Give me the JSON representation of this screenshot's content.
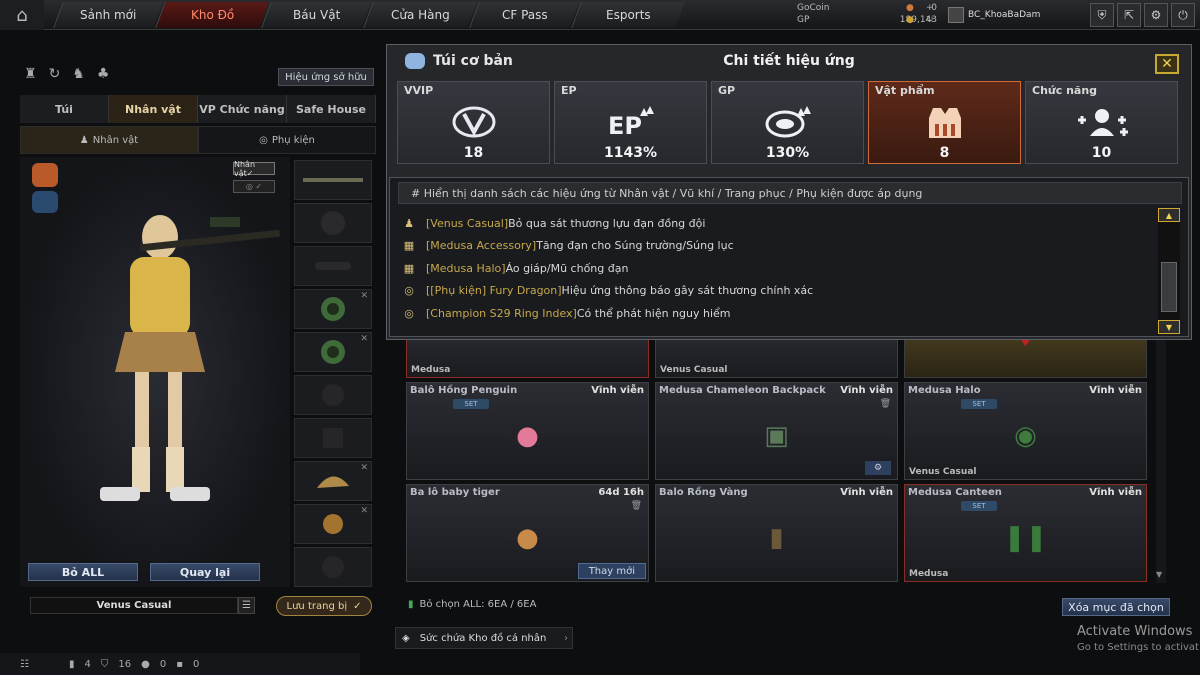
{
  "nav": {
    "tabs": [
      "Sảnh mới",
      "Kho Đồ",
      "Báu Vật",
      "Cửa Hàng",
      "CF Pass",
      "Esports"
    ],
    "active": "Kho Đồ"
  },
  "currency": {
    "gocoin_label": "GoCoin",
    "gocoin_value": "0",
    "gp_label": "GP",
    "gp_value": "189,143"
  },
  "user": {
    "name": "BC_KhoaBaDam"
  },
  "left": {
    "owned_effects_button": "Hiệu ứng sở hữu",
    "tabs": [
      "Túi",
      "Nhân vật",
      "VP Chức năng",
      "Safe House"
    ],
    "active_tab": "Nhân vật",
    "subtabs": [
      "Nhân vật",
      "Phụ kiện"
    ],
    "character_badge": "Nhân vật✓",
    "reset_all": "Bỏ ALL",
    "back": "Quay lại",
    "set_name": "Venus Casual",
    "save": "Lưu trang bị"
  },
  "status_bar": {
    "v1": "4",
    "v2": "16",
    "v3": "0",
    "v4": "0"
  },
  "modal": {
    "bag_title": "Túi cơ bản",
    "title": "Chi tiết hiệu ứng",
    "stats": [
      {
        "label": "VVIP",
        "value": "18",
        "icon": "vvip-icon"
      },
      {
        "label": "EP",
        "value": "1143%",
        "icon": "ep-up-icon"
      },
      {
        "label": "GP",
        "value": "130%",
        "icon": "gp-up-icon"
      },
      {
        "label": "Vật phẩm",
        "value": "8",
        "icon": "vest-icon"
      },
      {
        "label": "Chức năng",
        "value": "10",
        "icon": "users-plus-icon"
      }
    ],
    "effects_header": "# Hiển thị danh sách các hiệu ứng từ Nhân vật / Vũ khí / Trang phục / Phụ kiện được áp dụng",
    "effects": [
      {
        "tag": "[Venus Casual]",
        "text": "Bỏ qua sát thương lựu đạn đồng đội",
        "icon": "character-icon"
      },
      {
        "tag": "[Medusa Accessory]",
        "text": "Tăng đạn cho Súng trường/Súng lục",
        "icon": "vest-icon"
      },
      {
        "tag": "[Medusa Halo]",
        "text": "Áo giáp/Mũ chống đạn",
        "icon": "vest-icon"
      },
      {
        "tag": "[[Phụ kiện] Fury Dragon]",
        "text": "Hiệu ứng thông báo gây sát thương chính xác",
        "icon": "ring-icon"
      },
      {
        "tag": "[Champion S29 Ring Index]",
        "text": "Có thể phát hiện nguy hiểm",
        "icon": "ring-icon"
      }
    ]
  },
  "items": [
    {
      "name": "",
      "duration": "",
      "footer": "Medusa"
    },
    {
      "name": "",
      "duration": "",
      "footer": "Venus Casual"
    },
    {
      "name": "",
      "duration": "",
      "footer": ""
    },
    {
      "name": "Balô Hồng Penguin",
      "duration": "Vĩnh viễn",
      "set": "SET",
      "footer": ""
    },
    {
      "name": "Medusa Chameleon Backpack",
      "duration": "Vĩnh viễn",
      "footer": ""
    },
    {
      "name": "Medusa Halo",
      "duration": "Vĩnh viễn",
      "set": "SET",
      "footer": "Venus Casual"
    },
    {
      "name": "Ba lô baby tiger",
      "duration": "64d 16h",
      "footer": "",
      "button": "Thay mới"
    },
    {
      "name": "Balo Rồng Vàng",
      "duration": "Vĩnh viễn",
      "footer": ""
    },
    {
      "name": "Medusa Canteen",
      "duration": "Vĩnh viễn",
      "set": "SET",
      "footer": "Medusa"
    }
  ],
  "selection": {
    "text": "Bỏ chọn ALL: 6EA / 6EA",
    "clear": "Xóa mục đã chọn"
  },
  "capacity": {
    "label": "Sức chứa Kho đồ cá nhân"
  },
  "watermark": {
    "line1": "Activate Windows",
    "line2": "Go to Settings to activat"
  }
}
